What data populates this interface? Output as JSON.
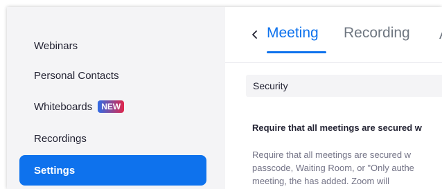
{
  "sidebar": {
    "items": [
      {
        "label": "Webinars",
        "active": false
      },
      {
        "label": "Personal Contacts",
        "active": false
      },
      {
        "label": "Whiteboards",
        "badge": "NEW",
        "active": false
      },
      {
        "label": "Recordings",
        "active": false
      },
      {
        "label": "Settings",
        "active": true
      }
    ]
  },
  "tabs": {
    "back_icon": "chevron-left-icon",
    "items": [
      "Meeting",
      "Recording"
    ],
    "truncated_next": "A",
    "active": "Meeting"
  },
  "section": {
    "title": "Security"
  },
  "setting": {
    "title": "Require that all meetings are secured w",
    "description_lines": [
      "Require that all meetings are secured w",
      "passcode, Waiting Room, or \"Only authe",
      "meeting, the has added. Zoom will"
    ]
  },
  "colors": {
    "accent": "#0e72ed",
    "sidebar_bg": "#f4f4f6",
    "badge_gradient": [
      "#2f6ce6",
      "#e0264b"
    ]
  }
}
